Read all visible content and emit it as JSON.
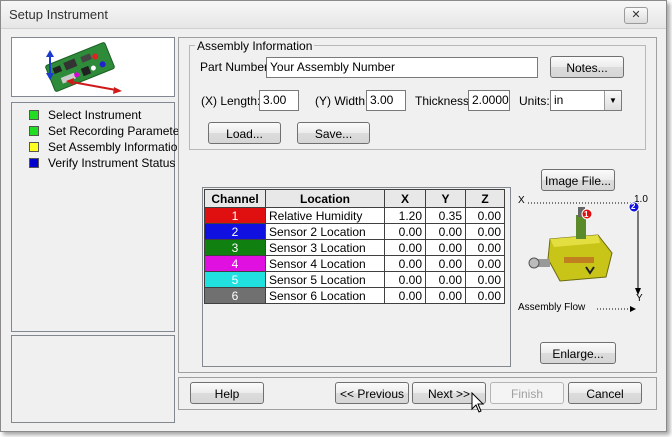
{
  "window": {
    "title": "Setup Instrument",
    "close_glyph": "✕"
  },
  "steps": [
    {
      "label": "Select Instrument",
      "color": "#22dd22"
    },
    {
      "label": "Set Recording Parameters",
      "color": "#22dd22"
    },
    {
      "label": "Set Assembly Information",
      "color": "#ffff22"
    },
    {
      "label": "Verify Instrument Status",
      "color": "#0000cc"
    }
  ],
  "assembly": {
    "group_label": "Assembly Information",
    "part_number_label": "Part Number:",
    "part_number_value": "Your Assembly Number",
    "notes_label": "Notes...",
    "length_label": "(X) Length:",
    "length_value": "3.00",
    "width_label": "(Y) Width:",
    "width_value": "3.00",
    "thickness_label": "Thickness:",
    "thickness_value": "2.0000",
    "units_label": "Units:",
    "units_value": "in",
    "load_label": "Load...",
    "save_label": "Save..."
  },
  "table": {
    "headers": [
      "Channel",
      "Location",
      "X",
      "Y",
      "Z"
    ],
    "rows": [
      {
        "channel": "1",
        "location": "Relative Humidity",
        "x": "1.20",
        "y": "0.35",
        "z": "0.00",
        "color": "#e01010"
      },
      {
        "channel": "2",
        "location": "Sensor 2 Location",
        "x": "0.00",
        "y": "0.00",
        "z": "0.00",
        "color": "#1010e0"
      },
      {
        "channel": "3",
        "location": "Sensor 3 Location",
        "x": "0.00",
        "y": "0.00",
        "z": "0.00",
        "color": "#108010"
      },
      {
        "channel": "4",
        "location": "Sensor 4 Location",
        "x": "0.00",
        "y": "0.00",
        "z": "0.00",
        "color": "#e010e0"
      },
      {
        "channel": "5",
        "location": "Sensor 5 Location",
        "x": "0.00",
        "y": "0.00",
        "z": "0.00",
        "color": "#20e0e0"
      },
      {
        "channel": "6",
        "location": "Sensor 6 Location",
        "x": "0.00",
        "y": "0.00",
        "z": "0.00",
        "color": "#707070"
      }
    ]
  },
  "image_panel": {
    "image_file_label": "Image File...",
    "axis_x": "X",
    "axis_y": "Y",
    "axis_x_max": "1.0",
    "marker_1": "1",
    "marker_2": "2",
    "flow_label": "Assembly Flow",
    "enlarge_label": "Enlarge..."
  },
  "footer": {
    "help": "Help",
    "previous": "<< Previous",
    "next": "Next >>",
    "finish": "Finish",
    "cancel": "Cancel"
  }
}
